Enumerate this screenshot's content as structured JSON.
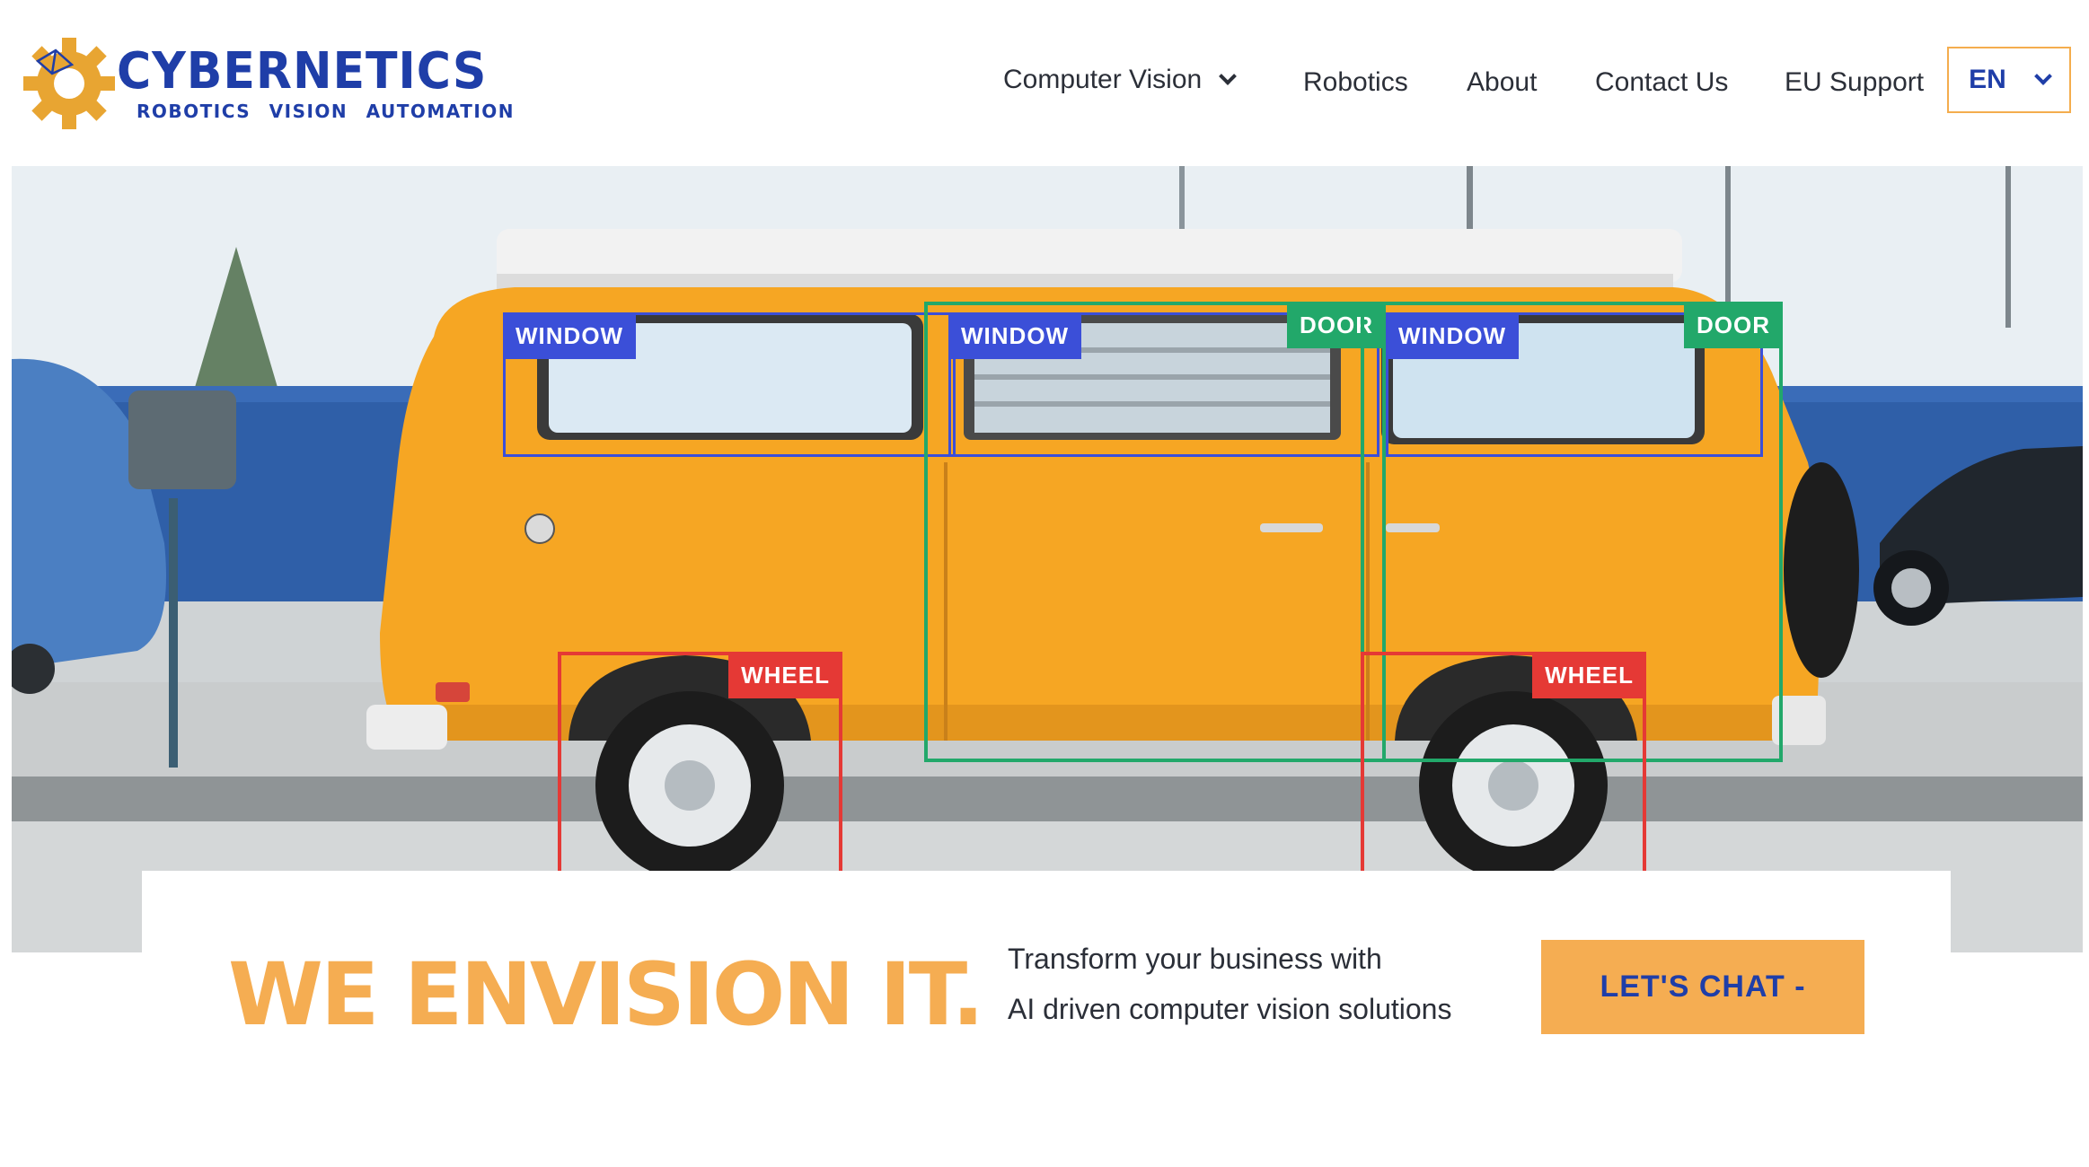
{
  "brand": {
    "name": "CYBERNETICS",
    "tagline": "ROBOTICS VISION AUTOMATION",
    "primary_color": "#1f3ea8",
    "accent_color": "#f5ad52",
    "gear_color": "#e8a532"
  },
  "nav": {
    "items": [
      {
        "label": "Computer Vision",
        "has_dropdown": true
      },
      {
        "label": "Robotics"
      },
      {
        "label": "About"
      },
      {
        "label": "Contact Us"
      },
      {
        "label": "EU Support"
      }
    ],
    "language": "EN"
  },
  "hero": {
    "detections": [
      {
        "label": "WINDOW",
        "color": "#3b4fd8"
      },
      {
        "label": "WINDOW",
        "color": "#3b4fd8"
      },
      {
        "label": "DOOR",
        "color": "#22a86a"
      },
      {
        "label": "WINDOW",
        "color": "#3b4fd8"
      },
      {
        "label": "DOOR",
        "color": "#22a86a"
      },
      {
        "label": "WHEEL",
        "color": "#e53935"
      },
      {
        "label": "WHEEL",
        "color": "#e53935"
      }
    ]
  },
  "cta_section": {
    "headline": "WE ENVISION IT.",
    "subtitle_line1": "Transform your business with",
    "subtitle_line2": "AI driven computer vision solutions",
    "button_label": "LET'S CHAT -"
  }
}
